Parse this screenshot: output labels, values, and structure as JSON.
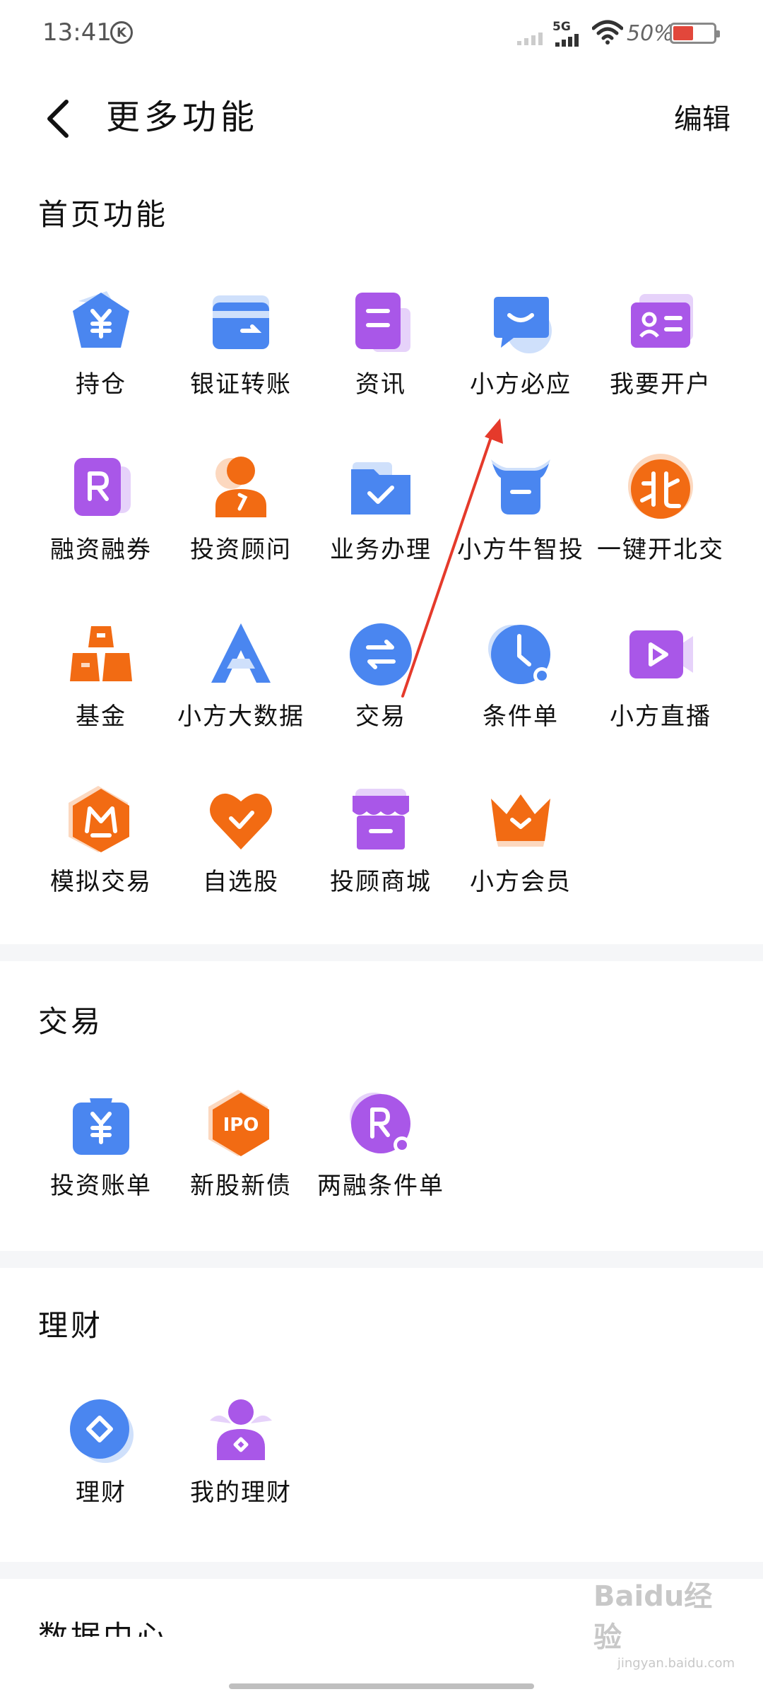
{
  "status_bar": {
    "time": "13:41",
    "carrier_badge": "K",
    "network": "5G",
    "battery_percent": "50%"
  },
  "header": {
    "title": "更多功能",
    "edit_label": "编辑"
  },
  "sections": {
    "home": {
      "title": "首页功能",
      "items": [
        {
          "label": "持仓",
          "icon": "yuan-pentagon-icon"
        },
        {
          "label": "银证转账",
          "icon": "bank-card-icon"
        },
        {
          "label": "资讯",
          "icon": "news-doc-icon"
        },
        {
          "label": "小方必应",
          "icon": "chat-bubble-icon"
        },
        {
          "label": "我要开户",
          "icon": "id-card-icon"
        },
        {
          "label": "融资融券",
          "icon": "r-card-icon"
        },
        {
          "label": "投资顾问",
          "icon": "advisor-person-icon"
        },
        {
          "label": "业务办理",
          "icon": "folder-check-icon"
        },
        {
          "label": "小方牛智投",
          "icon": "bull-icon"
        },
        {
          "label": "一键开北交",
          "icon": "bei-circle-icon"
        },
        {
          "label": "基金",
          "icon": "gold-bars-icon"
        },
        {
          "label": "小方大数据",
          "icon": "data-a-icon"
        },
        {
          "label": "交易",
          "icon": "swap-arrows-icon"
        },
        {
          "label": "条件单",
          "icon": "clock-icon"
        },
        {
          "label": "小方直播",
          "icon": "live-play-icon"
        },
        {
          "label": "模拟交易",
          "icon": "m-hexagon-icon"
        },
        {
          "label": "自选股",
          "icon": "heart-check-icon"
        },
        {
          "label": "投顾商城",
          "icon": "store-icon"
        },
        {
          "label": "小方会员",
          "icon": "crown-icon"
        }
      ]
    },
    "trade": {
      "title": "交易",
      "items": [
        {
          "label": "投资账单",
          "icon": "yuan-bill-icon"
        },
        {
          "label": "新股新债",
          "icon": "ipo-hexagon-icon"
        },
        {
          "label": "两融条件单",
          "icon": "r-clock-icon"
        }
      ]
    },
    "wealth": {
      "title": "理财",
      "items": [
        {
          "label": "理财",
          "icon": "diamond-circle-icon"
        },
        {
          "label": "我的理财",
          "icon": "wealth-person-icon"
        }
      ]
    },
    "data_center": {
      "title": "数据中心"
    }
  },
  "watermark": {
    "text": "Baidu经验",
    "sub": "jingyan.baidu.com"
  },
  "colors": {
    "blue": "#4a86f0",
    "light_blue": "#cfe0fb",
    "purple": "#a957e8",
    "light_purple": "#e6d2fa",
    "orange": "#f26b13",
    "light_orange": "#fcd8bf",
    "divider": "#f5f6f8",
    "arrow": "#e53a2b"
  }
}
